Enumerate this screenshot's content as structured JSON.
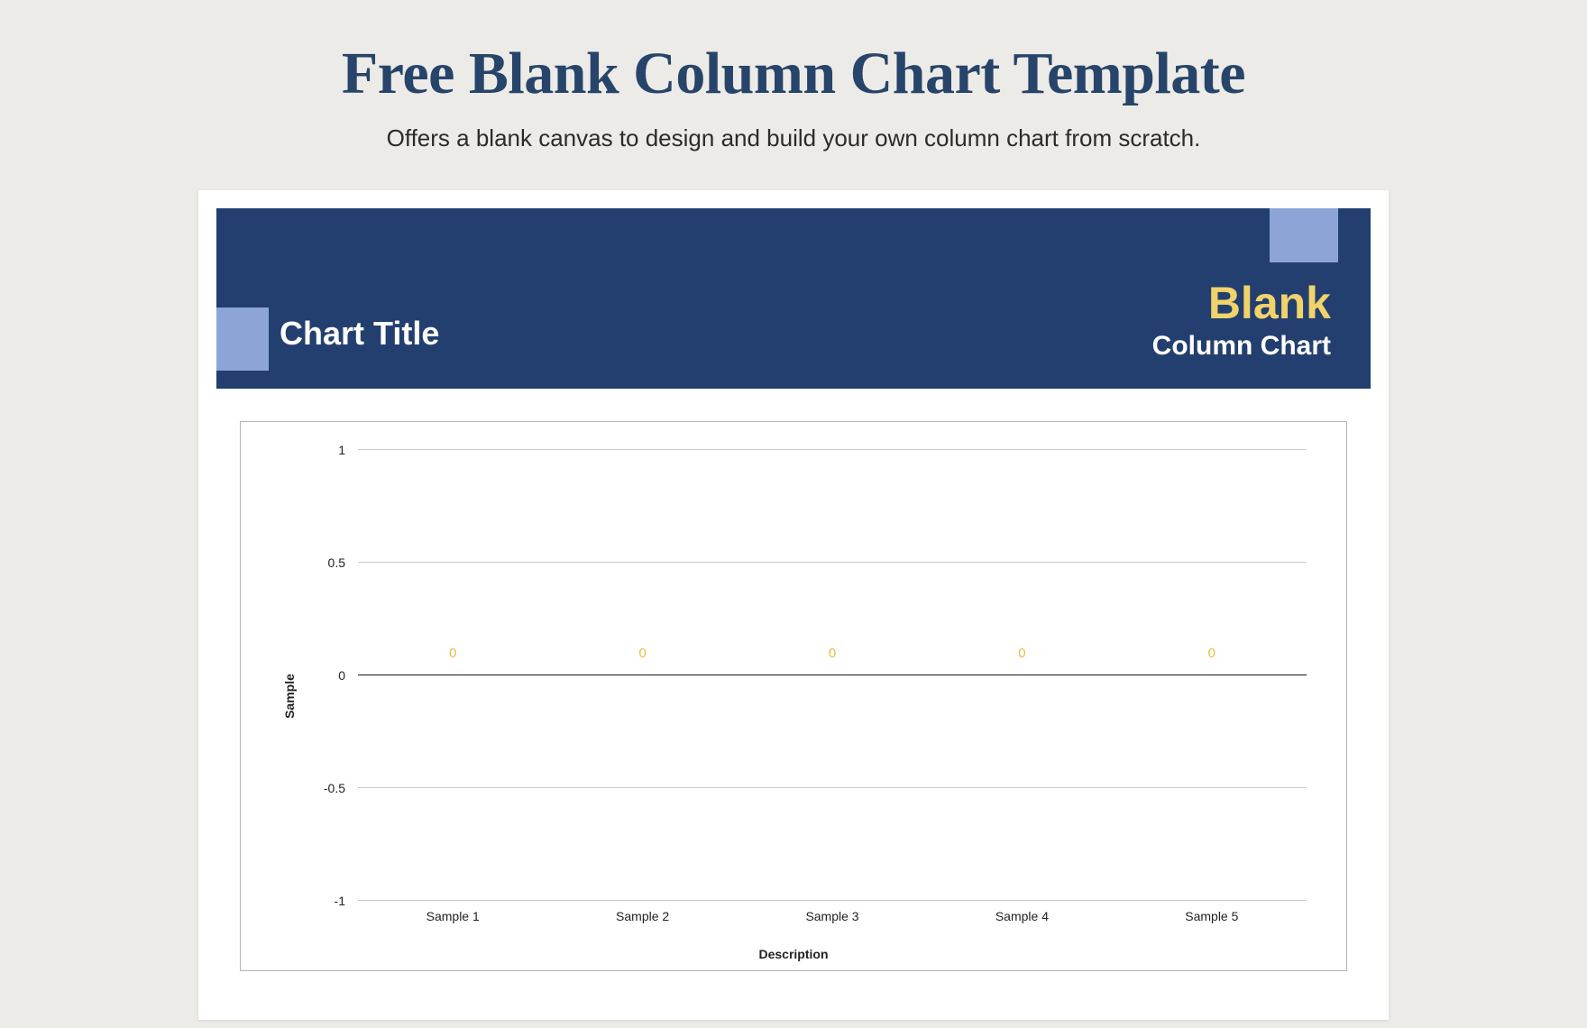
{
  "page": {
    "title": "Free Blank Column Chart Template",
    "subtitle": "Offers a blank canvas to design and build your own column chart from scratch."
  },
  "banner": {
    "chart_title_label": "Chart Title",
    "type_word": "Blank",
    "type_label": "Column Chart"
  },
  "chart_data": {
    "type": "bar",
    "categories": [
      "Sample 1",
      "Sample 2",
      "Sample 3",
      "Sample 4",
      "Sample 5"
    ],
    "values": [
      0,
      0,
      0,
      0,
      0
    ],
    "data_labels": [
      "0",
      "0",
      "0",
      "0",
      "0"
    ],
    "ylabel": "Sample",
    "xlabel": "Description",
    "ylim": [
      -1,
      1
    ],
    "yticks": [
      {
        "value": 1,
        "label": "1",
        "pct": 0
      },
      {
        "value": 0.5,
        "label": "0.5",
        "pct": 25
      },
      {
        "value": 0,
        "label": "0",
        "pct": 50
      },
      {
        "value": -0.5,
        "label": "-0.5",
        "pct": 75
      },
      {
        "value": -1,
        "label": "-1",
        "pct": 100
      }
    ]
  }
}
